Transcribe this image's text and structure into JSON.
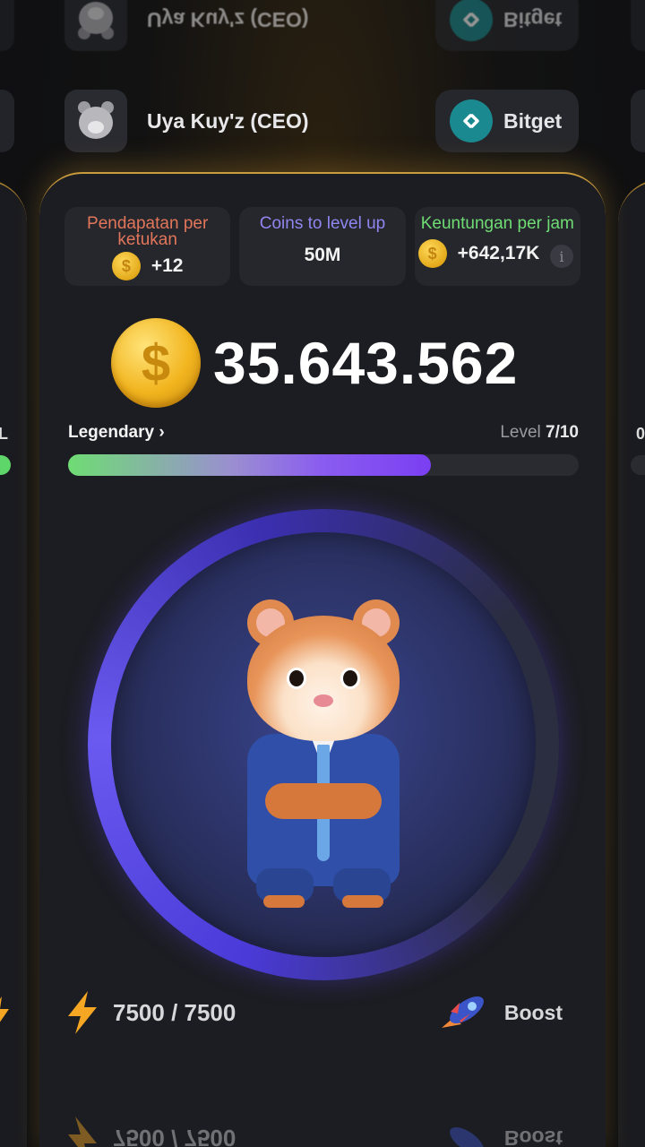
{
  "header": {
    "user_name": "Uya Kuy'z (CEO)",
    "user_name_mirrored": "Uya Kuy'z (CEO)",
    "exchange_label": "Bitget",
    "exchange_label_mirrored": "Bitget"
  },
  "stats": [
    {
      "label": "Pendapatan per ketukan",
      "value": "+12",
      "label_color": "#e2765a",
      "has_coin": true
    },
    {
      "label": "Coins to level up",
      "value": "50M",
      "label_color": "#8f86f0",
      "has_coin": false
    },
    {
      "label": "Keuntungan per jam",
      "value": "+642,17K",
      "label_color": "#6fdc74",
      "has_coin": true,
      "has_info": true
    }
  ],
  "balance": {
    "value": "35.643.562",
    "coin_symbol": "$"
  },
  "level": {
    "rank": "Legendary",
    "rank_chevron": "›",
    "label": "Level",
    "value": "7/10",
    "progress": 0.71
  },
  "edges": {
    "left_text": "L",
    "right_text": "0"
  },
  "energy": {
    "value": "7500 / 7500"
  },
  "boost": {
    "label": "Boost"
  },
  "colors": {
    "accent_gold": "#c89b3c",
    "exchange_teal": "#1a8a90",
    "progress_start": "#6fdc74",
    "progress_end": "#7a3ff2"
  },
  "icons": [
    "hamster-avatar-icon",
    "bitget-logo-icon",
    "coin-icon",
    "info-icon",
    "lightning-icon",
    "rocket-icon",
    "hamster-ceo-character"
  ]
}
